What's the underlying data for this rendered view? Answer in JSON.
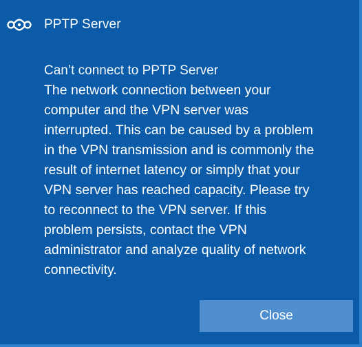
{
  "notification": {
    "app_name": "PPTP Server",
    "app_icon": "vpn-link-icon",
    "title": "Can’t connect to PPTP Server",
    "body": "The network connection between your\ncomputer and the VPN server was\ninterrupted.  This can be caused by a problem\nin the VPN transmission and is commonly the\nresult of internet latency or simply that your\nVPN server has reached capacity.  Please try\nto reconnect to the VPN server.  If this\nproblem persists, contact the VPN\nadministrator and analyze quality of network\nconnectivity.",
    "close_label": "Close"
  },
  "colors": {
    "background": "#0b5ba8",
    "button": "#4f8fcf",
    "text": "#ffffff"
  }
}
